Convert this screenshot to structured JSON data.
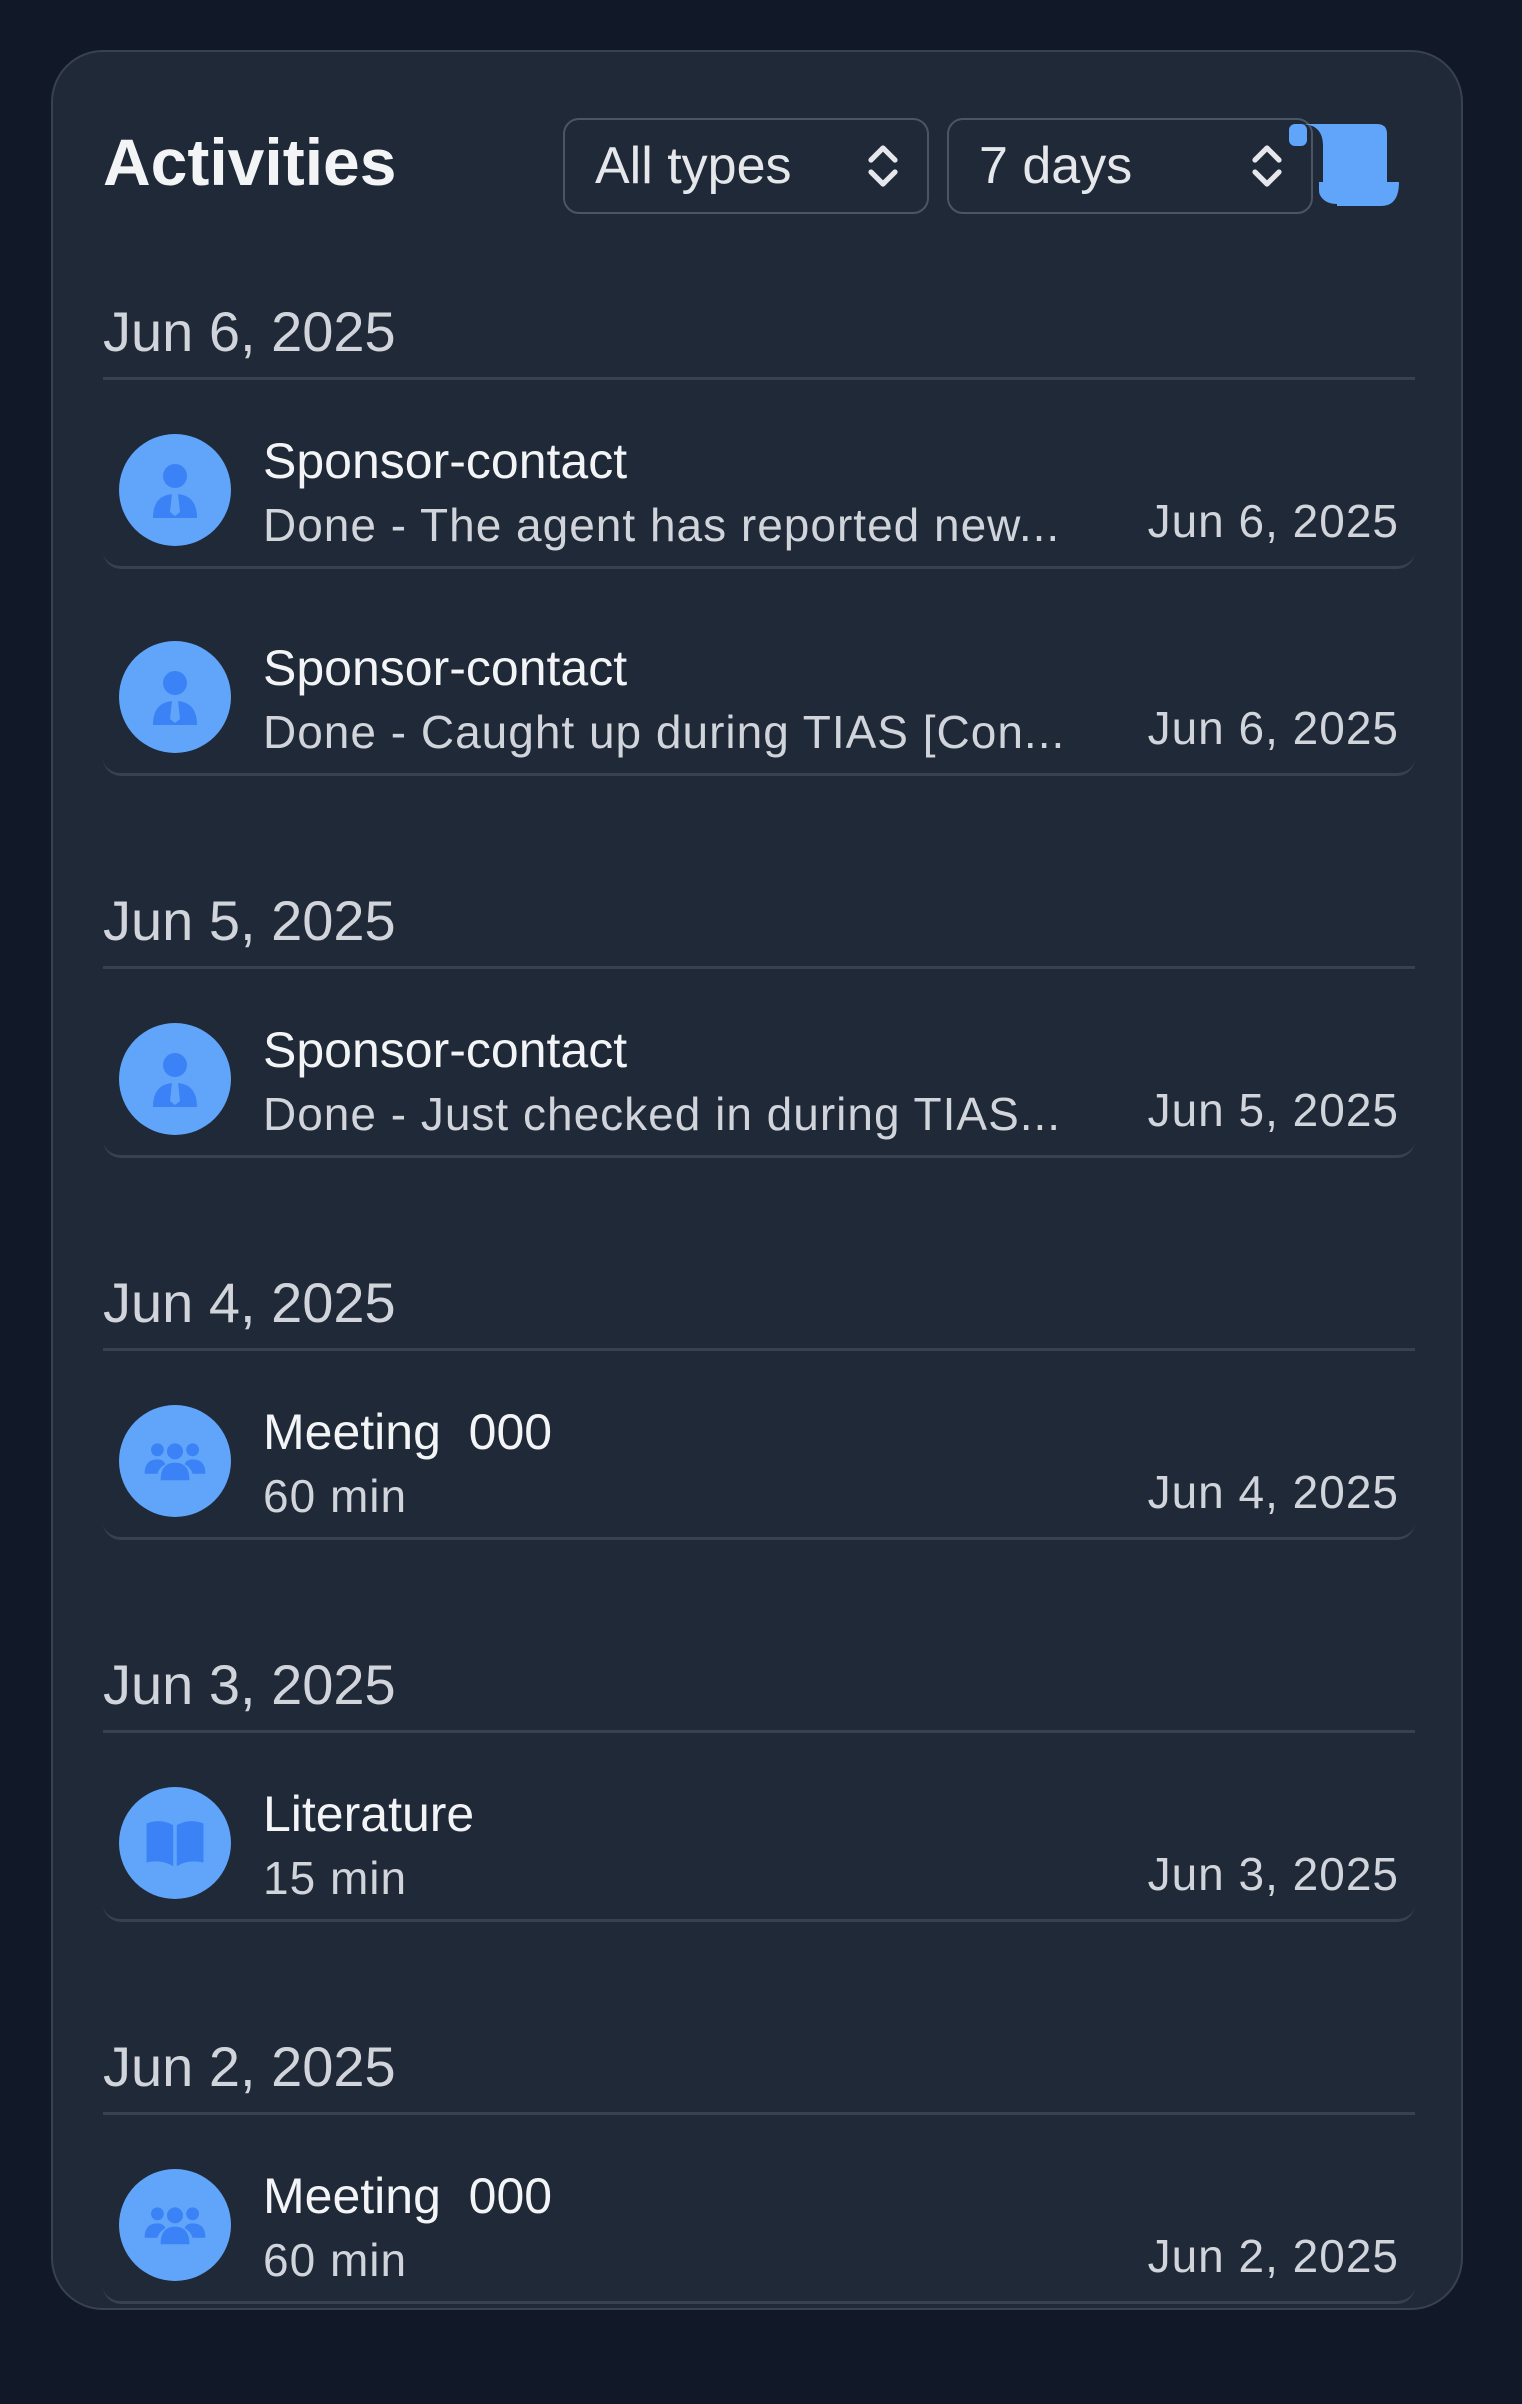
{
  "header": {
    "title": "Activities",
    "type_filter": "All types",
    "range_filter": "7 days",
    "action_icon": "scroll-icon"
  },
  "colors": {
    "background": "#111827",
    "card": "#1f2937",
    "accent": "#60a5fa"
  },
  "groups": [
    {
      "date": "Jun 6, 2025",
      "items": [
        {
          "icon": "user-tie-icon",
          "title": "Sponsor-contact",
          "subtitle": "Done - The agent has reported new...",
          "date": "Jun 6, 2025"
        },
        {
          "icon": "user-tie-icon",
          "title": "Sponsor-contact",
          "subtitle": "Done - Caught up during TIAS [Con...",
          "date": "Jun 6, 2025"
        }
      ]
    },
    {
      "date": "Jun 5, 2025",
      "items": [
        {
          "icon": "user-tie-icon",
          "title": "Sponsor-contact",
          "subtitle": "Done - Just checked in during TIAS...",
          "date": "Jun 5, 2025"
        }
      ]
    },
    {
      "date": "Jun 4, 2025",
      "items": [
        {
          "icon": "people-group-icon",
          "title": "Meeting  000",
          "subtitle": "60 min",
          "date": "Jun 4, 2025"
        }
      ]
    },
    {
      "date": "Jun 3, 2025",
      "items": [
        {
          "icon": "book-open-icon",
          "title": "Literature",
          "subtitle": "15 min",
          "date": "Jun 3, 2025"
        }
      ]
    },
    {
      "date": "Jun 2, 2025",
      "items": [
        {
          "icon": "people-group-icon",
          "title": "Meeting  000",
          "subtitle": "60 min",
          "date": "Jun 2, 2025"
        }
      ]
    }
  ]
}
